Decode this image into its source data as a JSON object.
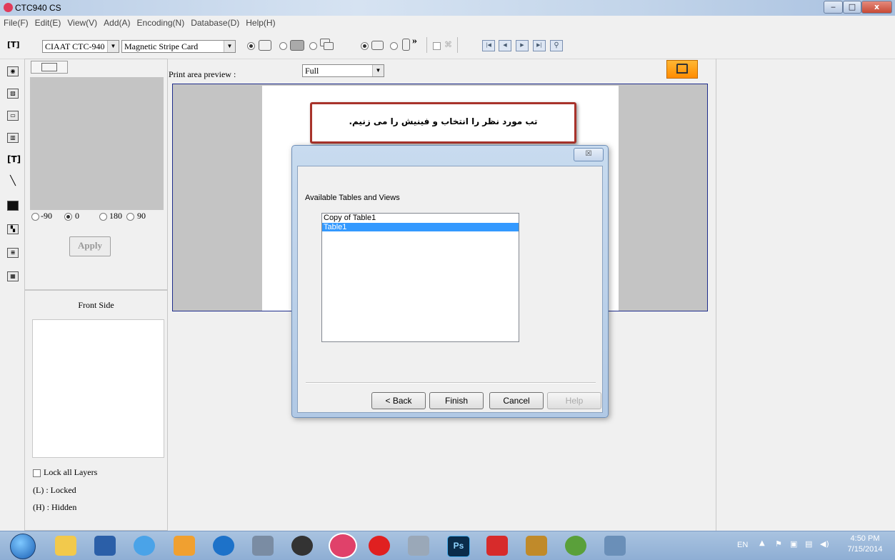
{
  "window": {
    "title": "CTC940 CS",
    "minimize": "‒",
    "maximize": "□",
    "close": "x"
  },
  "menu": [
    "File(F)",
    "Edit(E)",
    "View(V)",
    "Add(A)",
    "Encoding(N)",
    "Database(D)",
    "Help(H)"
  ],
  "toolbar": {
    "printer_select": "CIAAT CTC-940",
    "card_type_select": "Magnetic Stripe Card",
    "overflow_chevron": "»"
  },
  "rotation": {
    "options": [
      "-90",
      "0",
      "180",
      "90"
    ],
    "selected": "0"
  },
  "apply_label": "Apply",
  "layers": {
    "side_title": "Front Side",
    "lock_all_label": "Lock all Layers",
    "locked_legend": "(L) : Locked",
    "hidden_legend": "(H) : Hidden"
  },
  "preview": {
    "label": "Print area preview :",
    "selected": "Full"
  },
  "annotation": {
    "text": "تب مورد نظر را انتخاب و فینیش را می زنیم."
  },
  "dialog": {
    "close": "☒",
    "list_label": "Available Tables and Views",
    "items": [
      "Copy of Table1",
      "Table1"
    ],
    "selected_index": 1,
    "buttons": {
      "back": "< Back",
      "finish": "Finish",
      "cancel": "Cancel",
      "help": "Help"
    }
  },
  "taskbar": {
    "language": "EN",
    "time": "4:50 PM",
    "date": "7/15/2014",
    "apps": [
      "windows-explorer",
      "media-player",
      "internet-explorer",
      "outlook",
      "teamviewer",
      "tools",
      "ccleaner",
      "ctc940",
      "yandex",
      "scanner",
      "photoshop",
      "sketch",
      "pencil",
      "corel",
      "vmware"
    ]
  },
  "colors": {
    "accent_selection": "#3399ff",
    "annotation_border": "#a8332b",
    "preview_border": "#1e2c8c",
    "print_button": "#ff9900"
  }
}
